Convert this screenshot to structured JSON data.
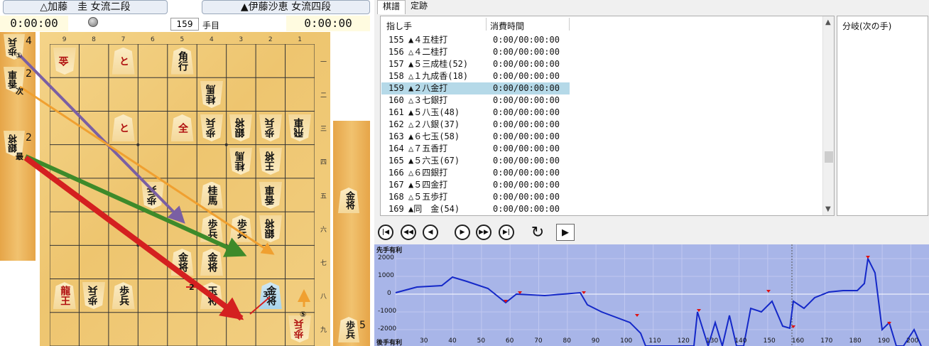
{
  "players": {
    "gote": "△加藤　圭 女流二段",
    "sente": "▲伊藤沙恵 女流四段"
  },
  "clocks": {
    "gote": "0:00:00",
    "sente": "0:00:00"
  },
  "move_number": "159",
  "move_unit": "手目",
  "file_labels": [
    "9",
    "8",
    "7",
    "6",
    "5",
    "4",
    "3",
    "2",
    "1"
  ],
  "rank_labels": [
    "一",
    "二",
    "三",
    "四",
    "五",
    "六",
    "七",
    "八",
    "九"
  ],
  "board": [
    {
      "file": 9,
      "rank": 1,
      "text": "金",
      "side": "gote",
      "red": true
    },
    {
      "file": 7,
      "rank": 1,
      "text": "と",
      "side": "sente",
      "red": true
    },
    {
      "file": 5,
      "rank": 1,
      "text": "角行",
      "side": "sente"
    },
    {
      "file": 4,
      "rank": 2,
      "text": "桂馬",
      "side": "gote"
    },
    {
      "file": 1,
      "rank": 3,
      "text": "飛車",
      "side": "gote"
    },
    {
      "file": 2,
      "rank": 3,
      "text": "歩兵",
      "side": "gote"
    },
    {
      "file": 3,
      "rank": 3,
      "text": "銀将",
      "side": "gote"
    },
    {
      "file": 4,
      "rank": 3,
      "text": "歩兵",
      "side": "gote"
    },
    {
      "file": 5,
      "rank": 3,
      "text": "全",
      "side": "sente",
      "red": true
    },
    {
      "file": 7,
      "rank": 3,
      "text": "と",
      "side": "sente",
      "red": true
    },
    {
      "file": 3,
      "rank": 4,
      "text": "桂馬",
      "side": "gote"
    },
    {
      "file": 2,
      "rank": 4,
      "text": "王将",
      "side": "gote"
    },
    {
      "file": 2,
      "rank": 5,
      "text": "香車",
      "side": "gote"
    },
    {
      "file": 4,
      "rank": 5,
      "text": "桂馬",
      "side": "sente"
    },
    {
      "file": 6,
      "rank": 5,
      "text": "歩兵",
      "side": "gote"
    },
    {
      "file": 2,
      "rank": 6,
      "text": "銀将",
      "side": "gote"
    },
    {
      "file": 3,
      "rank": 6,
      "text": "歩兵",
      "side": "sente"
    },
    {
      "file": 4,
      "rank": 6,
      "text": "歩兵",
      "side": "sente"
    },
    {
      "file": 4,
      "rank": 7,
      "text": "金将",
      "side": "sente"
    },
    {
      "file": 5,
      "rank": 7,
      "text": "金将",
      "side": "sente"
    },
    {
      "file": 9,
      "rank": 8,
      "text": "龍王",
      "side": "sente",
      "red": true
    },
    {
      "file": 8,
      "rank": 8,
      "text": "歩兵",
      "side": "gote"
    },
    {
      "file": 7,
      "rank": 8,
      "text": "歩兵",
      "side": "sente"
    },
    {
      "file": 4,
      "rank": 8,
      "text": "玉将",
      "side": "sente"
    },
    {
      "file": 2,
      "rank": 8,
      "text": "金将",
      "side": "sente",
      "highlight": true
    },
    {
      "file": 1,
      "rank": 9,
      "text": "歩兵",
      "side": "gote",
      "red": true
    }
  ],
  "gote_hand": [
    {
      "text": "歩兵",
      "count": "4"
    },
    {
      "text": "香車",
      "count": "2"
    },
    {
      "text": "銀将",
      "count": "2"
    }
  ],
  "sente_hand": [
    {
      "text": "金将",
      "count": ""
    },
    {
      "text": "歩兵",
      "count": "5"
    }
  ],
  "arrow_tags": [
    "①",
    "次",
    "最",
    "2",
    "3",
    "⑤"
  ],
  "tabs": [
    "棋譜",
    "定跡"
  ],
  "kifu": {
    "headers": {
      "move": "指し手",
      "time": "消費時間"
    },
    "rows": [
      {
        "n": "155",
        "m": "▲４五桂打",
        "t": "0:00/00:00:00"
      },
      {
        "n": "156",
        "m": "△４二桂打",
        "t": "0:00/00:00:00"
      },
      {
        "n": "157",
        "m": "▲５三成桂(52)",
        "t": "0:00/00:00:00"
      },
      {
        "n": "158",
        "m": "△１九成香(18)",
        "t": "0:00/00:00:00"
      },
      {
        "n": "159",
        "m": "▲２八金打",
        "t": "0:00/00:00:00",
        "selected": true
      },
      {
        "n": "160",
        "m": "△３七銀打",
        "t": "0:00/00:00:00"
      },
      {
        "n": "161",
        "m": "▲５八玉(48)",
        "t": "0:00/00:00:00"
      },
      {
        "n": "162",
        "m": "△２八銀(37)",
        "t": "0:00/00:00:00"
      },
      {
        "n": "163",
        "m": "▲６七玉(58)",
        "t": "0:00/00:00:00"
      },
      {
        "n": "164",
        "m": "△７五香打",
        "t": "0:00/00:00:00"
      },
      {
        "n": "165",
        "m": "▲５六玉(67)",
        "t": "0:00/00:00:00"
      },
      {
        "n": "166",
        "m": "△６四銀打",
        "t": "0:00/00:00:00"
      },
      {
        "n": "167",
        "m": "▲５四金打",
        "t": "0:00/00:00:00"
      },
      {
        "n": "168",
        "m": "△５五歩打",
        "t": "0:00/00:00:00"
      },
      {
        "n": "169",
        "m": "▲同　金(54)",
        "t": "0:00/00:00:00"
      }
    ]
  },
  "branch": {
    "title": "分岐(次の手)"
  },
  "graph": {
    "top_label": "先手有利",
    "bottom_label": "後手有利",
    "y_ticks": [
      "2000",
      "1000",
      "0",
      "-1000",
      "-2000"
    ],
    "x_ticks": [
      "30",
      "40",
      "50",
      "60",
      "70",
      "80",
      "90",
      "100",
      "110",
      "120",
      "130",
      "140",
      "150",
      "160",
      "170",
      "180",
      "190",
      "200"
    ],
    "series_color": "#1428c8"
  }
}
